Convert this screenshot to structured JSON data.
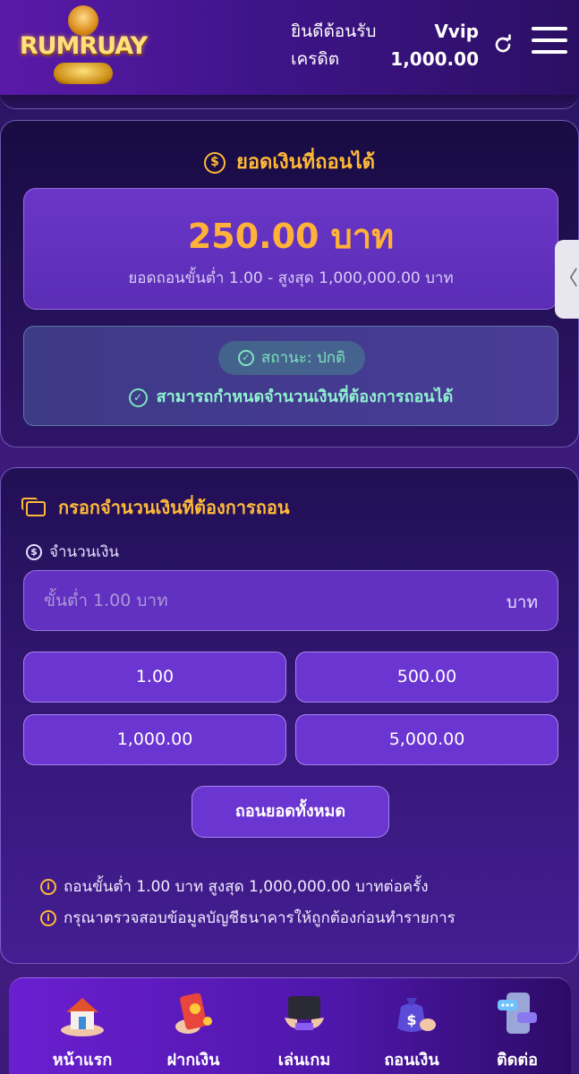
{
  "header": {
    "logo_text": "RUMRUAY",
    "welcome": "ยินดีต้อนรับ",
    "credit_label": "เครดิต",
    "vip_level": "Vvip",
    "credit_amount": "1,000.00"
  },
  "withdrawable": {
    "title": "ยอดเงินที่ถอนได้",
    "amount": "250.00 บาท",
    "range": "ยอดถอนขั้นต่ำ 1.00 - สูงสุด 1,000,000.00 บาท",
    "status": "สถานะ: ปกติ",
    "status_message": "สามารถกำหนดจำนวนเงินที่ต้องการถอนได้"
  },
  "form": {
    "title": "กรอกจำนวนเงินที่ต้องการถอน",
    "field_label": "จำนวนเงิน",
    "input_placeholder": "ขั้นต่ำ 1.00 บาท",
    "input_value": "",
    "input_unit": "บาท",
    "quick_amounts": [
      "1.00",
      "500.00",
      "1,000.00",
      "5,000.00"
    ],
    "withdraw_all_label": "ถอนยอดทั้งหมด",
    "notes": [
      "ถอนขั้นต่ำ 1.00 บาท สูงสุด 1,000,000.00 บาทต่อครั้ง",
      "กรุณาตรวจสอบข้อมูลบัญชีธนาคารให้ถูกต้องก่อนทำรายการ"
    ]
  },
  "side_tab": "〈",
  "nav": {
    "items": [
      {
        "label": "หน้าแรก",
        "icon": "home-icon"
      },
      {
        "label": "ฝากเงิน",
        "icon": "deposit-icon"
      },
      {
        "label": "เล่นเกม",
        "icon": "game-icon"
      },
      {
        "label": "ถอนเงิน",
        "icon": "withdraw-icon"
      },
      {
        "label": "ติดต่อ",
        "icon": "contact-icon"
      }
    ]
  },
  "colors": {
    "accent": "#ffb938",
    "status_green": "#8ff0cf",
    "button_purple": "#6a35d0"
  }
}
